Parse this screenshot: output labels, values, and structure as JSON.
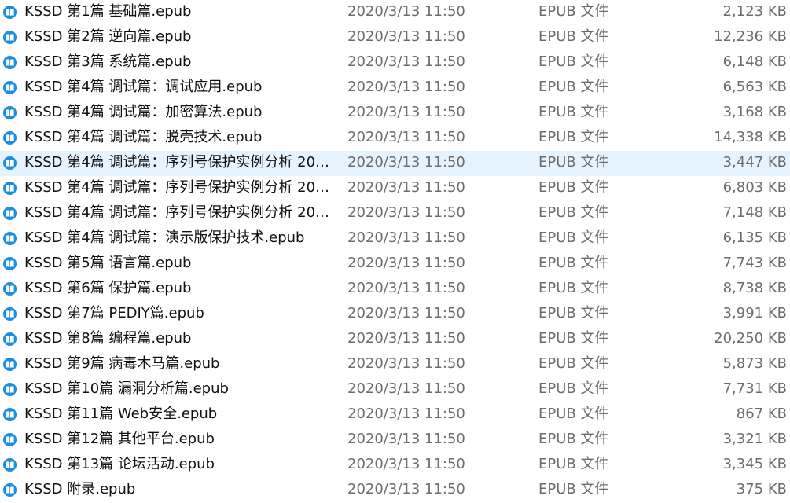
{
  "file_list": {
    "icon": "epub-file-icon",
    "accent_color": "#1a8fe0",
    "selected_row_color": "#e5f3ff",
    "rows": [
      {
        "name": "KSSD 第1篇 基础篇.epub",
        "date": "2020/3/13 11:50",
        "type": "EPUB 文件",
        "size": "2,123 KB"
      },
      {
        "name": "KSSD 第2篇 逆向篇.epub",
        "date": "2020/3/13 11:50",
        "type": "EPUB 文件",
        "size": "12,236 KB"
      },
      {
        "name": "KSSD 第3篇 系统篇.epub",
        "date": "2020/3/13 11:50",
        "type": "EPUB 文件",
        "size": "6,148 KB"
      },
      {
        "name": "KSSD 第4篇 调试篇：调试应用.epub",
        "date": "2020/3/13 11:50",
        "type": "EPUB 文件",
        "size": "6,563 KB"
      },
      {
        "name": "KSSD 第4篇 调试篇：加密算法.epub",
        "date": "2020/3/13 11:50",
        "type": "EPUB 文件",
        "size": "3,168 KB"
      },
      {
        "name": "KSSD 第4篇 调试篇：脱壳技术.epub",
        "date": "2020/3/13 11:50",
        "type": "EPUB 文件",
        "size": "14,338 KB"
      },
      {
        "name": "KSSD 第4篇 调试篇：序列号保护实例分析 200...",
        "date": "2020/3/13 11:50",
        "type": "EPUB 文件",
        "size": "3,447 KB",
        "selected": true
      },
      {
        "name": "KSSD 第4篇 调试篇：序列号保护实例分析 200...",
        "date": "2020/3/13 11:50",
        "type": "EPUB 文件",
        "size": "6,803 KB"
      },
      {
        "name": "KSSD 第4篇 调试篇：序列号保护实例分析 200...",
        "date": "2020/3/13 11:50",
        "type": "EPUB 文件",
        "size": "7,148 KB"
      },
      {
        "name": "KSSD 第4篇 调试篇：演示版保护技术.epub",
        "date": "2020/3/13 11:50",
        "type": "EPUB 文件",
        "size": "6,135 KB"
      },
      {
        "name": "KSSD 第5篇 语言篇.epub",
        "date": "2020/3/13 11:50",
        "type": "EPUB 文件",
        "size": "7,743 KB"
      },
      {
        "name": "KSSD 第6篇 保护篇.epub",
        "date": "2020/3/13 11:50",
        "type": "EPUB 文件",
        "size": "8,738 KB"
      },
      {
        "name": "KSSD 第7篇 PEDIY篇.epub",
        "date": "2020/3/13 11:50",
        "type": "EPUB 文件",
        "size": "3,991 KB"
      },
      {
        "name": "KSSD 第8篇 编程篇.epub",
        "date": "2020/3/13 11:50",
        "type": "EPUB 文件",
        "size": "20,250 KB"
      },
      {
        "name": "KSSD 第9篇 病毒木马篇.epub",
        "date": "2020/3/13 11:50",
        "type": "EPUB 文件",
        "size": "5,873 KB"
      },
      {
        "name": "KSSD 第10篇 漏洞分析篇.epub",
        "date": "2020/3/13 11:50",
        "type": "EPUB 文件",
        "size": "7,731 KB"
      },
      {
        "name": "KSSD 第11篇 Web安全.epub",
        "date": "2020/3/13 11:50",
        "type": "EPUB 文件",
        "size": "867 KB"
      },
      {
        "name": "KSSD 第12篇 其他平台.epub",
        "date": "2020/3/13 11:50",
        "type": "EPUB 文件",
        "size": "3,321 KB"
      },
      {
        "name": "KSSD 第13篇 论坛活动.epub",
        "date": "2020/3/13 11:50",
        "type": "EPUB 文件",
        "size": "3,345 KB"
      },
      {
        "name": "KSSD 附录.epub",
        "date": "2020/3/13 11:50",
        "type": "EPUB 文件",
        "size": "375 KB"
      }
    ]
  }
}
